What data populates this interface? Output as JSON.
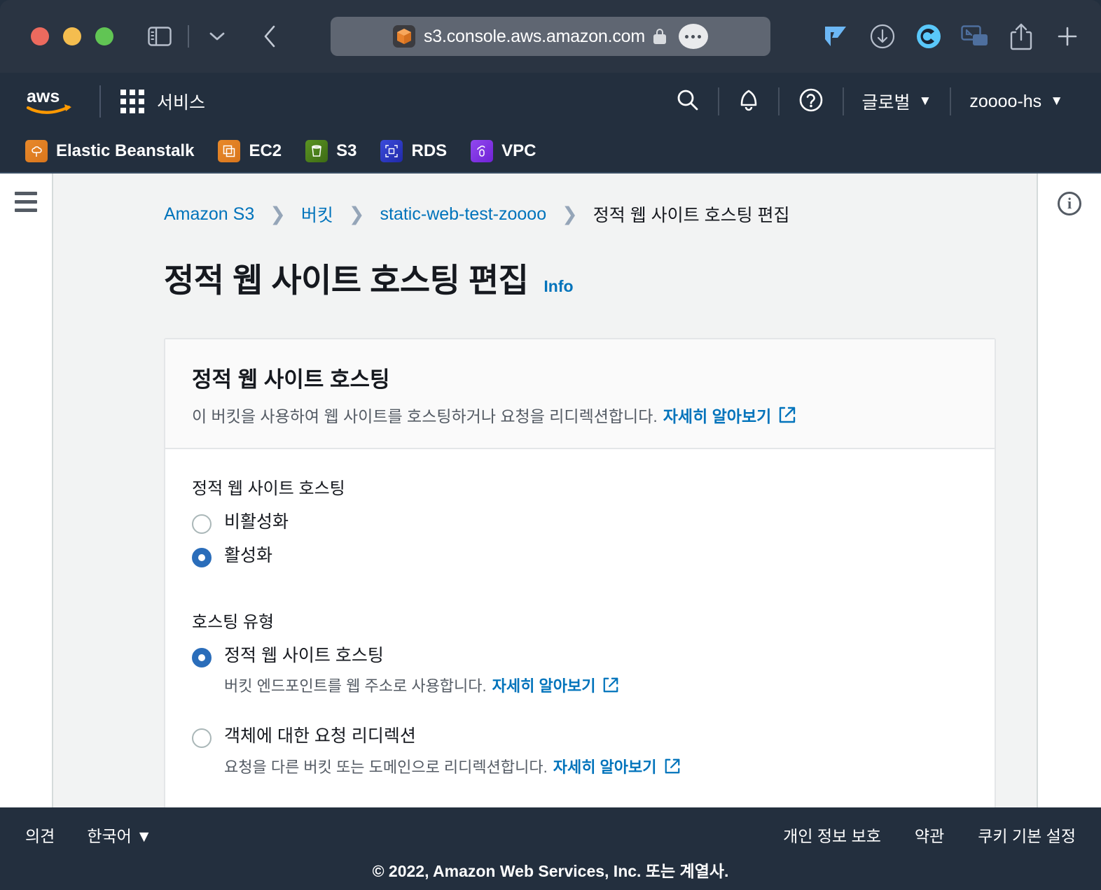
{
  "browser": {
    "url": "s3.console.aws.amazon.com",
    "favicon_name": "s3-bucket-favicon",
    "lock_name": "lock-icon",
    "traffic_lights": [
      "close",
      "minimize",
      "maximize"
    ],
    "toolbar_icons": [
      "sidebar-toggle-icon",
      "chevron-down-icon",
      "back-arrow-icon",
      "vimium-extension-icon",
      "download-icon",
      "coinbase-extension-icon",
      "picture-in-picture-icon",
      "share-icon",
      "new-tab-icon"
    ]
  },
  "aws_nav": {
    "logo_name": "aws-logo",
    "services_label": "서비스",
    "search_icon": "search-icon",
    "bell_icon": "notifications-bell-icon",
    "help_icon": "help-question-icon",
    "region_label": "글로벌",
    "account_label": "zoooo-hs",
    "caret": "▼"
  },
  "favorites": [
    {
      "label": "Elastic Beanstalk",
      "icon": "elastic-beanstalk-icon",
      "color": "#e8892b",
      "glyph": "☁"
    },
    {
      "label": "EC2",
      "icon": "ec2-icon",
      "color": "#e8892b",
      "glyph": "▣"
    },
    {
      "label": "S3",
      "icon": "s3-icon",
      "color": "#4f7d1e",
      "glyph": "▤"
    },
    {
      "label": "RDS",
      "icon": "rds-icon",
      "color": "#2e3ad1",
      "glyph": "⬚"
    },
    {
      "label": "VPC",
      "icon": "vpc-icon",
      "color": "#8433e0",
      "glyph": "⬛"
    }
  ],
  "breadcrumb": {
    "items": [
      {
        "label": "Amazon S3",
        "is_link": true
      },
      {
        "label": "버킷",
        "is_link": true
      },
      {
        "label": "static-web-test-zoooo",
        "is_link": true
      },
      {
        "label": "정적 웹 사이트 호스팅 편집",
        "is_link": false
      }
    ],
    "separator": "❯"
  },
  "page": {
    "title": "정적 웹 사이트 호스팅 편집",
    "info_link": "Info",
    "hamburger_icon": "hamburger-menu-icon",
    "info_panel_icon": "info-circle-icon"
  },
  "card": {
    "title": "정적 웹 사이트 호스팅",
    "description": "이 버킷을 사용하여 웹 사이트를 호스팅하거나 요청을 리디렉션합니다.",
    "learn_more": "자세히 알아보기",
    "external_icon": "external-link-icon"
  },
  "hosting_toggle": {
    "label": "정적 웹 사이트 호스팅",
    "options": [
      {
        "label": "비활성화",
        "selected": false
      },
      {
        "label": "활성화",
        "selected": true
      }
    ]
  },
  "hosting_type": {
    "label": "호스팅 유형",
    "options": [
      {
        "label": "정적 웹 사이트 호스팅",
        "description": "버킷 엔드포인트를 웹 주소로 사용합니다.",
        "learn_more": "자세히 알아보기",
        "selected": true
      },
      {
        "label": "객체에 대한 요청 리디렉션",
        "description": "요청을 다른 버킷 또는 도메인으로 리디렉션합니다.",
        "learn_more": "자세히 알아보기",
        "selected": false
      }
    ]
  },
  "footer": {
    "feedback": "의견",
    "language": "한국어",
    "language_caret": "▼",
    "privacy": "개인 정보 보호",
    "terms": "약관",
    "cookie": "쿠키 기본 설정",
    "copyright": "© 2022, Amazon Web Services, Inc. 또는 계열사."
  },
  "colors": {
    "aws_navy": "#232f3e",
    "link_blue": "#0073bb",
    "radio_blue": "#2a6dba",
    "page_bg": "#f2f3f3",
    "aws_orange": "#ff9900"
  }
}
